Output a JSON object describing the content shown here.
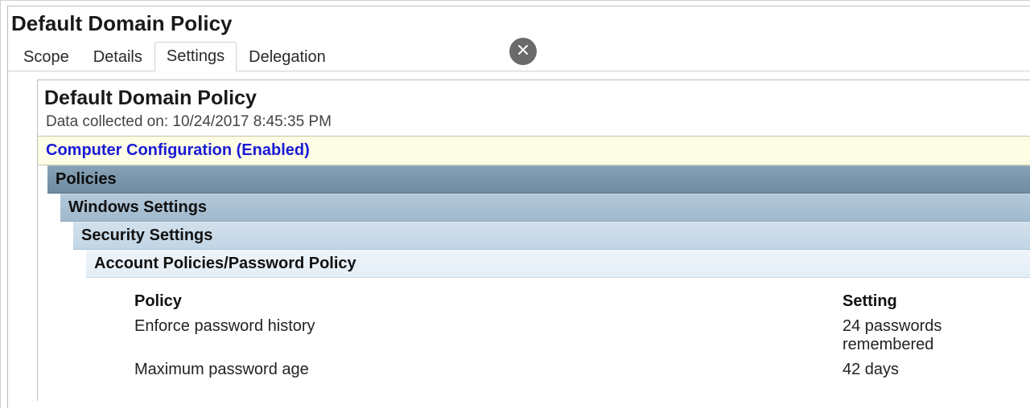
{
  "window": {
    "title": "Default Domain Policy"
  },
  "tabs": {
    "scope": "Scope",
    "details": "Details",
    "settings": "Settings",
    "delegation": "Delegation"
  },
  "panel": {
    "title": "Default Domain Policy",
    "collected_label": "Data collected on: ",
    "collected_value": "10/24/2017 8:45:35 PM"
  },
  "sections": {
    "computer_config": "Computer Configuration (Enabled)",
    "policies": "Policies",
    "windows_settings": "Windows Settings",
    "security_settings": "Security Settings",
    "account_policies": "Account Policies/Password Policy"
  },
  "table": {
    "header_policy": "Policy",
    "header_setting": "Setting",
    "rows": [
      {
        "policy": "Enforce password history",
        "setting": "24 passwords remembered"
      },
      {
        "policy": "Maximum password age",
        "setting": "42 days"
      }
    ]
  },
  "close_button": {
    "label": "Close"
  }
}
